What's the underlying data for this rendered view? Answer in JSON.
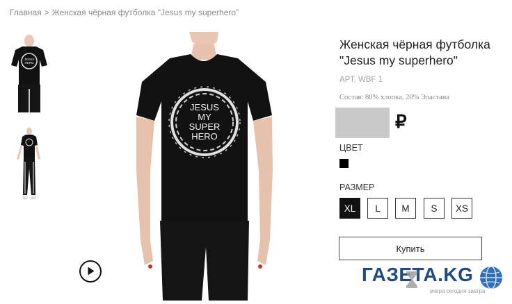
{
  "breadcrumb": {
    "home": "Главная",
    "separator": ">",
    "current": "Женская чёрная футболка \"Jesus my superhero\""
  },
  "gallery": {
    "thumbnails": [
      "tshirt-front-thumbnail",
      "model-full-body-thumbnail"
    ],
    "main_image": "woman-in-black-tshirt-photo",
    "shirt_print": [
      "JESUS",
      "MY",
      "SUPER",
      "HERO"
    ],
    "play_icon": "play-icon"
  },
  "product": {
    "title": "Женская чёрная футболка \"Jesus my superhero\"",
    "article": "АРТ. WBF 1",
    "composition": "Состав: 80% хлопка, 20% Эластана",
    "currency": "₽"
  },
  "color": {
    "label": "ЦВЕТ",
    "value": "#000000"
  },
  "size": {
    "label": "РАЗМЕР",
    "options": [
      "XL",
      "L",
      "M",
      "S",
      "XS"
    ],
    "selected": "XL"
  },
  "buy_label": "Купить",
  "watermark": {
    "text": "ГАЗЕТА.KG",
    "tagline": "вчера сегодня завтра"
  },
  "colors": {
    "accent": "#111111",
    "price_placeholder": "#c9c9c9",
    "watermark_blue": "#1e4b85"
  }
}
